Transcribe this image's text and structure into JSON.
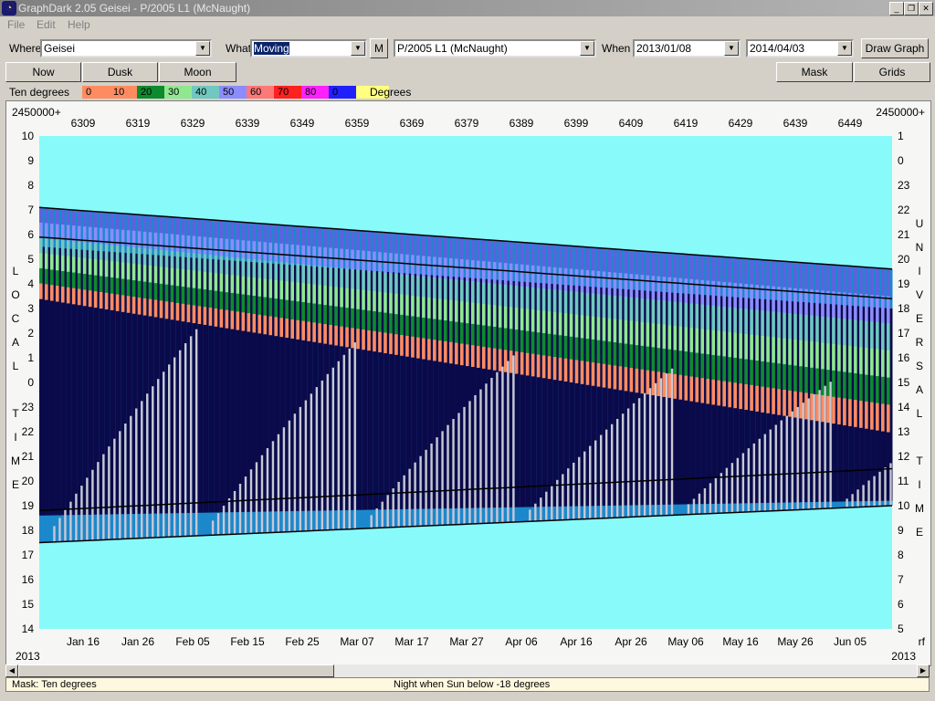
{
  "window": {
    "title": "GraphDark 2.05  Geisei  -  P/2005 L1 (McNaught)",
    "icon": "app-icon"
  },
  "menu": [
    "File",
    "Edit",
    "Help"
  ],
  "toolbar": {
    "where_label": "Where",
    "where_value": "Geisei",
    "what_label": "What",
    "what_value": "Moving",
    "m_button": "M",
    "object_value": "P/2005 L1 (McNaught)",
    "when_label": "When",
    "start_date": "2013/01/08",
    "end_date": "2014/04/03",
    "draw_button": "Draw Graph"
  },
  "buttons2": {
    "now": "Now",
    "dusk": "Dusk",
    "moon": "Moon",
    "mask": "Mask",
    "grids": "Grids"
  },
  "legend": {
    "label": "Ten degrees",
    "units": "Degrees",
    "entries": [
      {
        "text": "0",
        "color": "#ff8c60"
      },
      {
        "text": "10",
        "color": "#ff8c60"
      },
      {
        "text": "20",
        "color": "#0e8a2e"
      },
      {
        "text": "30",
        "color": "#8fe88f"
      },
      {
        "text": "40",
        "color": "#70c8c0"
      },
      {
        "text": "50",
        "color": "#8c8cff"
      },
      {
        "text": "60",
        "color": "#ff7878"
      },
      {
        "text": "70",
        "color": "#ff2020"
      },
      {
        "text": "80",
        "color": "#ff20ff"
      },
      {
        "text": "0",
        "color": "#2020ff"
      },
      {
        "text": "",
        "color": "#ffff80"
      }
    ]
  },
  "chart_data": {
    "type": "heatmap",
    "jd_prefix_left": "2450000+",
    "jd_prefix_right": "2450000+",
    "top_ticks": [
      "6309",
      "6319",
      "6329",
      "6339",
      "6349",
      "6359",
      "6369",
      "6379",
      "6389",
      "6399",
      "6409",
      "6419",
      "6429",
      "6439",
      "6449"
    ],
    "bottom_ticks": [
      "Jan 16",
      "Jan 26",
      "Feb 05",
      "Feb 15",
      "Feb 25",
      "Mar 07",
      "Mar 17",
      "Mar 27",
      "Apr 06",
      "Apr 16",
      "Apr 26",
      "May 06",
      "May 16",
      "May 26",
      "Jun 05"
    ],
    "year_left": "2013",
    "year_right": "2013",
    "right_corner": "rf",
    "left_ticks": [
      "10",
      "9",
      "8",
      "7",
      "6",
      "5",
      "4",
      "3",
      "2",
      "1",
      "0",
      "23",
      "22",
      "21",
      "20",
      "19",
      "18",
      "17",
      "16",
      "15",
      "14"
    ],
    "right_ticks": [
      "1",
      "0",
      "23",
      "22",
      "21",
      "20",
      "19",
      "18",
      "17",
      "16",
      "15",
      "14",
      "13",
      "12",
      "11",
      "10",
      "9",
      "8",
      "7",
      "6",
      "5"
    ],
    "left_axis_label": "LOCAL TIME",
    "left_axis_letters": [
      "L",
      "O",
      "C",
      "A",
      "L",
      "",
      "T",
      "I",
      "M",
      "E"
    ],
    "right_axis_letters": [
      "U",
      "N",
      "I",
      "V",
      "E",
      "R",
      "S",
      "A",
      "L",
      "",
      "T",
      "I",
      "M",
      "E"
    ],
    "background_color": "#88fafa",
    "night_color": "#0a0a4a",
    "twilight_color": "#1c88cc",
    "moon_color": "#c8c8d4"
  },
  "status": {
    "mask": "Mask:  Ten degrees",
    "night": "Night when Sun below -18 degrees"
  }
}
